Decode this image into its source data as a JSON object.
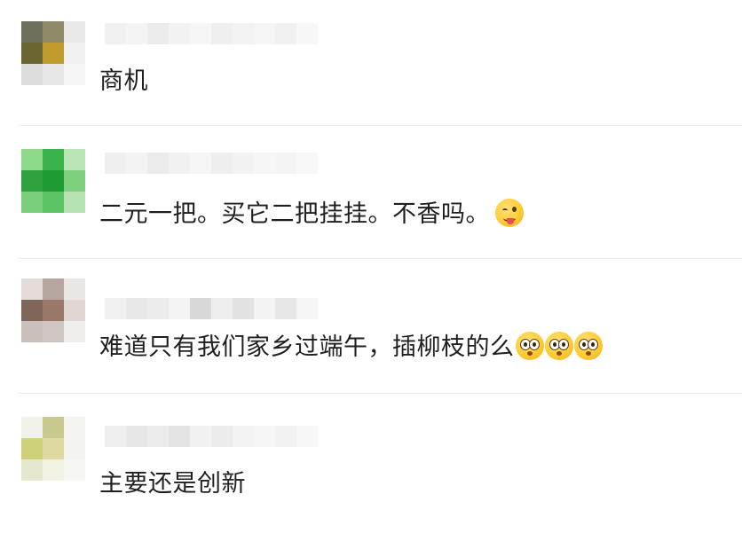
{
  "comments": [
    {
      "text": "商机",
      "avatar_colors": [
        "#6f6f5e",
        "#8d8a68",
        "#e9e9ea",
        "#6b6531",
        "#c19c2c",
        "#f0f0f0",
        "#dcdcdc",
        "#e6e6e6",
        "#f6f6f6"
      ],
      "name_colors": [
        "#f0f0f0",
        "#f4f4f4",
        "#ececec",
        "#f2f2f2",
        "#f6f6f6",
        "#efefef",
        "#f3f3f3",
        "#f5f5f5",
        "#f1f1f1",
        "#f7f7f7"
      ]
    },
    {
      "text": "二元一把。买它二把挂挂。不香吗。",
      "emojis": [
        "tongue-wink-emoji"
      ],
      "avatar_colors": [
        "#8fd98a",
        "#39b34a",
        "#b9e6b4",
        "#2fa13e",
        "#1e9a33",
        "#7fd07e",
        "#7ccf7a",
        "#5cc464",
        "#b6e3b2"
      ],
      "name_colors": [
        "#efefef",
        "#f3f3f3",
        "#ebebeb",
        "#f1f1f1",
        "#f5f5f5",
        "#eeeeee",
        "#f2f2f2",
        "#f6f6f6",
        "#f4f4f4",
        "#f8f8f8"
      ]
    },
    {
      "text": "难道只有我们家乡过端午，插柳枝的么",
      "emojis": [
        "wide-eyes-emoji",
        "wide-eyes-emoji",
        "wide-eyes-emoji"
      ],
      "avatar_colors": [
        "#e4dcd9",
        "#b7a59f",
        "#eae6e4",
        "#7e6659",
        "#99786a",
        "#e0d6d2",
        "#c9c0bc",
        "#cdc6c3",
        "#f0eeed"
      ],
      "name_colors": [
        "#f0f0f0",
        "#e8e8e8",
        "#ececec",
        "#f4f4f4",
        "#d8d8d8",
        "#eeeeee",
        "#e2e2e2",
        "#f3f3f3",
        "#e6e6e6",
        "#f5f5f5"
      ]
    },
    {
      "text": "主要还是创新",
      "avatar_colors": [
        "#f2f2ea",
        "#c7c98e",
        "#f4f4f0",
        "#cfd07c",
        "#ddd9a0",
        "#f3f3ef",
        "#e6e7cf",
        "#f1f1e4",
        "#f6f6f4"
      ],
      "name_colors": [
        "#efefef",
        "#e7e7e7",
        "#ebebeb",
        "#e4e4e4",
        "#f1f1f1",
        "#ececec",
        "#f3f3f3",
        "#f6f6f6",
        "#f2f2f2",
        "#f7f7f7"
      ]
    }
  ]
}
